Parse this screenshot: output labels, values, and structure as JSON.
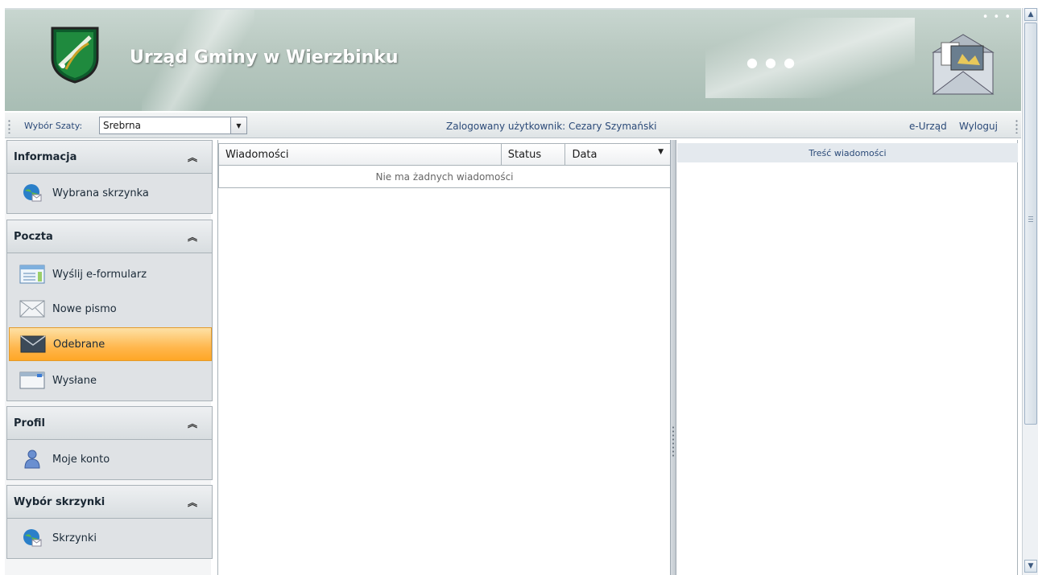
{
  "header": {
    "title": "Urząd Gminy w Wierzbinku",
    "logo_icon": "coat-of-arms-icon",
    "graphic_icon": "mail-envelope-graphic-icon"
  },
  "toolbar": {
    "skin_label": "Wybór Szaty:",
    "skin_value": "Srebrna",
    "logged_user": "Zalogowany użytkownik: Cezary Szymański",
    "eurzad_link": "e-Urząd",
    "logout_link": "Wyloguj"
  },
  "sidebar": {
    "groups": [
      {
        "title": "Informacja",
        "items": [
          {
            "label": "Wybrana skrzynka",
            "icon": "globe-mail-icon"
          }
        ]
      },
      {
        "title": "Poczta",
        "items": [
          {
            "label": "Wyślij e-formularz",
            "icon": "form-icon"
          },
          {
            "label": "Nowe pismo",
            "icon": "envelope-icon"
          },
          {
            "label": "Odebrane",
            "icon": "inbox-envelope-icon",
            "active": true
          },
          {
            "label": "Wysłane",
            "icon": "sent-card-icon"
          }
        ]
      },
      {
        "title": "Profil",
        "items": [
          {
            "label": "Moje konto",
            "icon": "user-icon"
          }
        ]
      },
      {
        "title": "Wybór skrzynki",
        "items": [
          {
            "label": "Skrzynki",
            "icon": "globe-mail-icon"
          }
        ]
      }
    ]
  },
  "messages": {
    "columns": [
      "Wiadomości",
      "Status",
      "Data"
    ],
    "empty_text": "Nie ma żadnych wiadomości"
  },
  "content": {
    "header": "Treść wiadomości"
  },
  "colors": {
    "accent": "#ffa726",
    "link": "#2b4a78",
    "banner": "#b9c9c1"
  }
}
